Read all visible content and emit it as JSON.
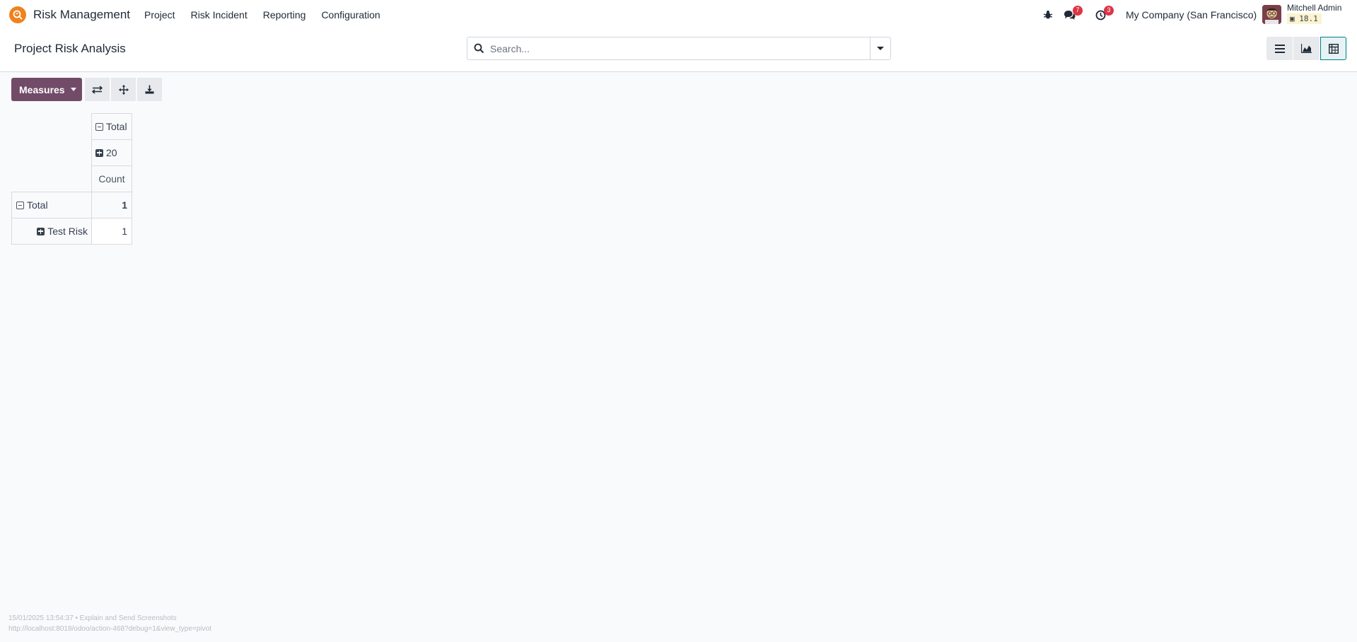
{
  "navbar": {
    "app_name": "Risk Management",
    "menu": [
      "Project",
      "Risk Incident",
      "Reporting",
      "Configuration"
    ],
    "messages_count": "7",
    "activities_count": "3",
    "company": "My Company (San Francisco)",
    "user_name": "Mitchell Admin",
    "db_version": "18.1"
  },
  "control_panel": {
    "title": "Project Risk Analysis",
    "search_placeholder": "Search..."
  },
  "toolbar": {
    "measures_label": "Measures"
  },
  "pivot": {
    "col_total_label": "Total",
    "col_group_label": "20",
    "measure_label": "Count",
    "row_total_label": "Total",
    "row_total_value": "1",
    "rows": [
      {
        "label": "Test Risk",
        "value": "1"
      }
    ]
  },
  "footer": {
    "line1": "15/01/2025 13:54:37 • Explain and Send Screenshots",
    "line2": "http://localhost:8018/odoo/action-468?debug=1&view_type=pivot"
  },
  "colors": {
    "primary": "#714b67",
    "accent": "#017e84",
    "badge": "#dc3545",
    "app_icon": "#f0821e"
  }
}
